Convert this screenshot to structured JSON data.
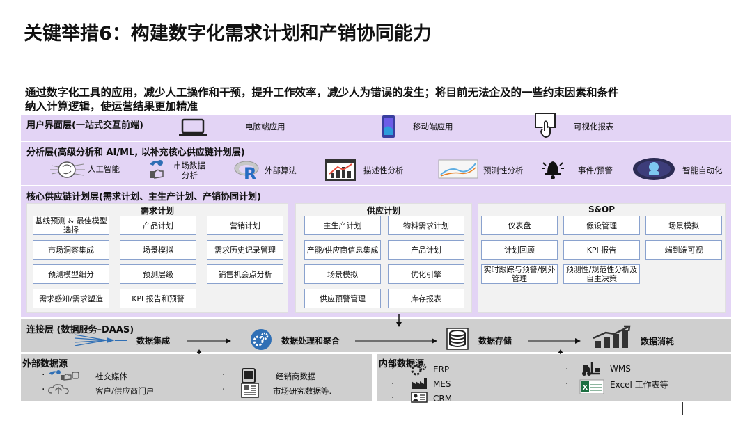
{
  "title": "关键举措6：构建数字化需求计划和产销协同能力",
  "intro": {
    "line1": "通过数字化工具的应用，减少人工操作和干预，提升工作效率，减少人为错误的发生；将目前无法企及的一些约束因素和条件",
    "line2": "纳入计算逻辑，使运营结果更加精准"
  },
  "ui_layer": {
    "title": "用户界面层(一站式交互前端)",
    "items": [
      "电脑端应用",
      "移动端应用",
      "可视化报表"
    ]
  },
  "analytics_layer": {
    "title": "分析层(高级分析和 AI/ML, 以补充核心供应链计划层)",
    "items": [
      "人工智能",
      "市场数据",
      "分析",
      "外部算法",
      "描述性分析",
      "预测性分析",
      "事件/预警",
      "智能自动化"
    ]
  },
  "core_layer": {
    "title": "核心供应链计划层(需求计划、主生产计划、产销协同计划)",
    "demand": {
      "title": "需求计划",
      "boxes": [
        "基线预测 & 最佳模型选择",
        "产品计划",
        "营销计划",
        "市场洞察集成",
        "场景模拟",
        "需求历史记录管理",
        "预测模型细分",
        "预测层级",
        "销售机会点分析",
        "需求感知/需求塑造",
        "KPI 报告和预警"
      ]
    },
    "supply": {
      "title": "供应计划",
      "boxes": [
        "主生产计划",
        "物料需求计划",
        "产能/供应商信息集成",
        "产品计划",
        "场景模拟",
        "优化引擎",
        "供应预警管理",
        "库存报表"
      ]
    },
    "sop": {
      "title": "S&OP",
      "boxes": [
        "仪表盘",
        "假设管理",
        "场景模拟",
        "计划回顾",
        "KPI 报告",
        "端到端可视",
        "实时跟踪与预警/例外管理",
        "预测性/规范性分析及自主决策"
      ]
    }
  },
  "connect_layer": {
    "title": "连接层 (数据服务–DAAS)",
    "steps": [
      "数据集成",
      "数据处理和聚合",
      "数据存储",
      "数据消耗"
    ]
  },
  "external": {
    "title": "外部数据源",
    "items": [
      "社交媒体",
      "客户/供应商门户",
      "经销商数据",
      "市场研究数据等."
    ]
  },
  "internal": {
    "title": "内部数据源",
    "items": [
      "ERP",
      "MES",
      "CRM",
      "WMS",
      "Excel 工作表等"
    ]
  },
  "colors": {
    "purple_band": "#e3d4f5",
    "gray_band": "#cfcfcf",
    "box_border": "#8aa2ce",
    "icon_blue": "#2f6fb5"
  }
}
